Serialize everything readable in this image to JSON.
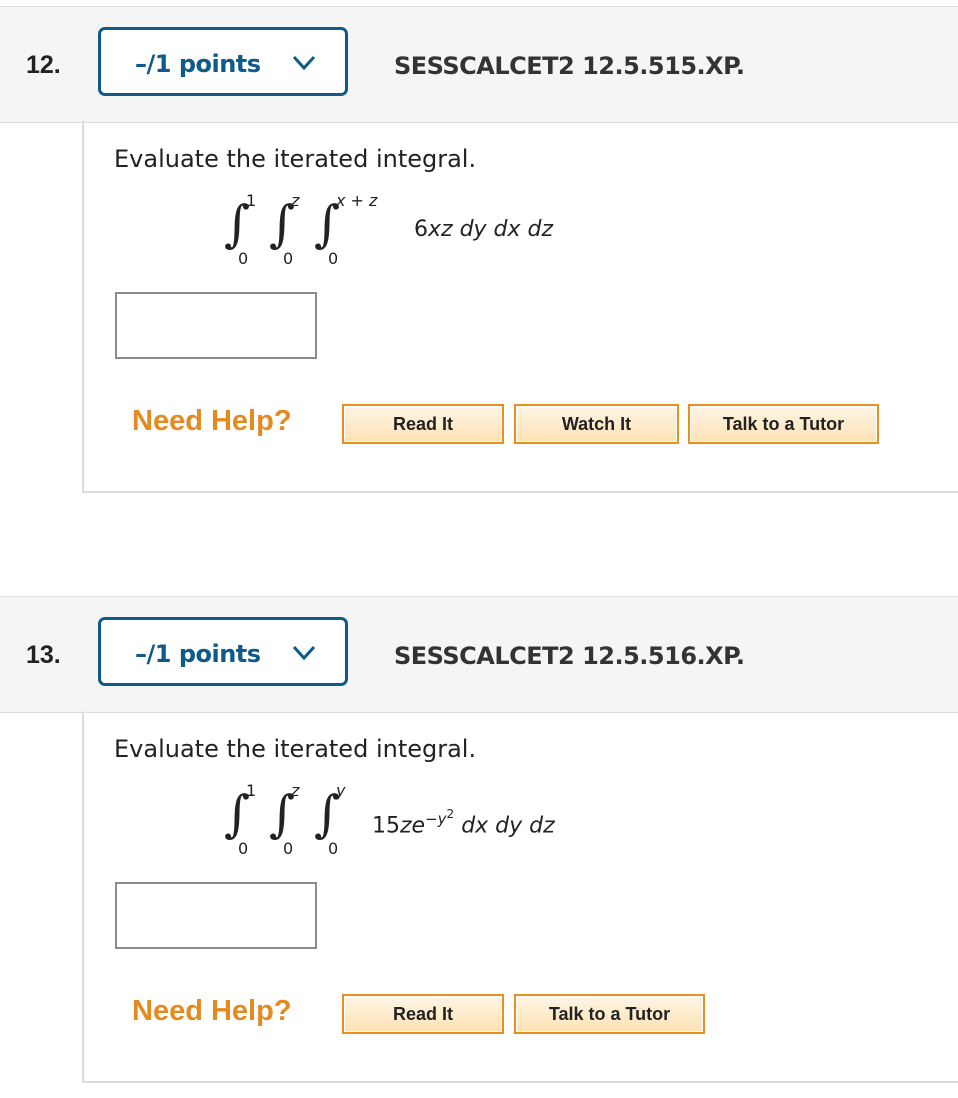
{
  "questions": [
    {
      "number": "12.",
      "points_label": "–/1 points",
      "code": "SESSCALCET2 12.5.515.XP.",
      "prompt": "Evaluate the iterated integral.",
      "integral": {
        "limits": [
          {
            "upper": "1",
            "lower": "0"
          },
          {
            "upper": "z",
            "lower": "0"
          },
          {
            "upper": "x + z",
            "lower": "0"
          }
        ],
        "integrand_coef": "6",
        "integrand_vars": "xz",
        "differentials": "dy dx dz"
      },
      "answer_value": "",
      "need_help": "Need Help?",
      "help_buttons": [
        "Read It",
        "Watch It",
        "Talk to a Tutor"
      ]
    },
    {
      "number": "13.",
      "points_label": "–/1 points",
      "code": "SESSCALCET2 12.5.516.XP.",
      "prompt": "Evaluate the iterated integral.",
      "integral": {
        "limits": [
          {
            "upper": "1",
            "lower": "0"
          },
          {
            "upper": "z",
            "lower": "0"
          },
          {
            "upper": "y",
            "lower": "0"
          }
        ],
        "integrand_coef": "15",
        "integrand_vars": "ze",
        "exponent_base": "−y",
        "exponent_power": "2",
        "differentials": "dx dy dz"
      },
      "answer_value": "",
      "need_help": "Need Help?",
      "help_buttons": [
        "Read It",
        "Talk to a Tutor"
      ]
    }
  ],
  "colors": {
    "primary": "#0e5a8a",
    "help_orange": "#e58a1f",
    "header_bg": "#f5f5f5"
  },
  "icons": {
    "points_dropdown": "chevron-down-icon"
  }
}
